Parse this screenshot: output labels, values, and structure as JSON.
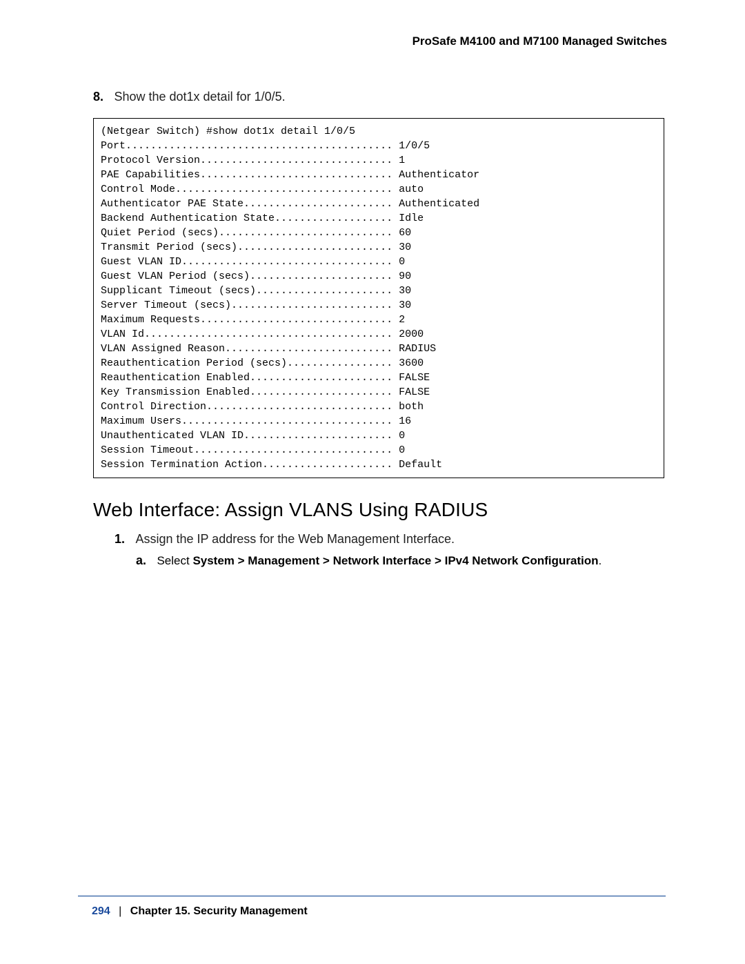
{
  "header": {
    "title": "ProSafe M4100 and M7100 Managed Switches"
  },
  "step8": {
    "number": "8.",
    "text": "Show the dot1x detail for 1/0/5."
  },
  "codeblock": "(Netgear Switch) #show dot1x detail 1/0/5\nPort........................................... 1/0/5\nProtocol Version............................... 1\nPAE Capabilities............................... Authenticator\nControl Mode................................... auto\nAuthenticator PAE State........................ Authenticated\nBackend Authentication State................... Idle\nQuiet Period (secs)............................ 60\nTransmit Period (secs)......................... 30\nGuest VLAN ID.................................. 0\nGuest VLAN Period (secs)....................... 90\nSupplicant Timeout (secs)...................... 30\nServer Timeout (secs).......................... 30\nMaximum Requests............................... 2\nVLAN Id........................................ 2000\nVLAN Assigned Reason........................... RADIUS\nReauthentication Period (secs)................. 3600\nReauthentication Enabled....................... FALSE\nKey Transmission Enabled....................... FALSE\nControl Direction.............................. both\nMaximum Users.................................. 16\nUnauthenticated VLAN ID........................ 0\nSession Timeout................................ 0\nSession Termination Action..................... Default",
  "section_heading": "Web Interface: Assign VLANS Using RADIUS",
  "step1": {
    "number": "1.",
    "text": "Assign the IP address for the Web Management Interface."
  },
  "step_a": {
    "letter": "a.",
    "prefix": "Select ",
    "bold": "System > Management > Network Interface > IPv4 Network Configuration",
    "suffix": "."
  },
  "footer": {
    "page": "294",
    "sep": "|",
    "chapter": "Chapter 15.  Security Management"
  }
}
